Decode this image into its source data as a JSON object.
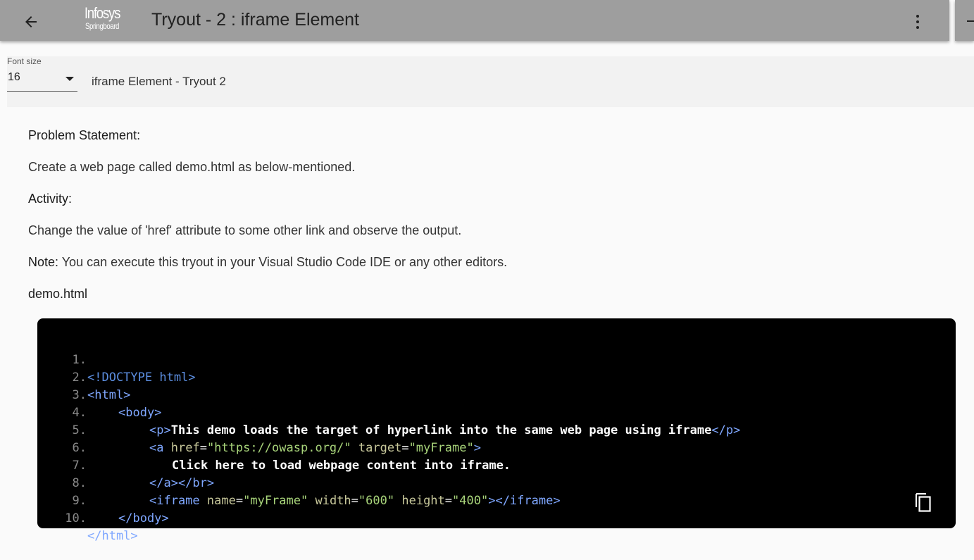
{
  "header": {
    "logo_line1": "Infosys",
    "logo_line2": "Springboard",
    "title": "Tryout - 2 : iframe Element"
  },
  "toolbar": {
    "font_size_label": "Font size",
    "font_size_value": "16",
    "lesson_title": "iframe Element - Tryout 2"
  },
  "content": {
    "problem_heading": "Problem Statement:",
    "problem_text": "Create a web page called demo.html as below-mentioned.",
    "activity_heading": "Activity:",
    "activity_text": "Change the value of 'href' attribute to some other link and observe the output.",
    "note_label": "Note:",
    "note_text": " You can execute this tryout in your Visual Studio Code IDE or any other editors.",
    "file_name": "demo.html"
  },
  "code": {
    "line_numbers": [
      "1.",
      "2.",
      "3.",
      "4.",
      "5.",
      "6.",
      "7.",
      "8.",
      "9.",
      "10."
    ],
    "l1": "<!DOCTYPE html>",
    "l2": "<html>",
    "l3": "<body>",
    "l4_open": "<p>",
    "l4_text": "This demo loads the target of hyperlink into the same web page using iframe",
    "l4_close": "</p>",
    "l5_tag": "<a",
    "l5_attr1": "href",
    "l5_val1": "\"https://owasp.org/\"",
    "l5_attr2": "target",
    "l5_val2": "\"myFrame\"",
    "l5_end": ">",
    "l6_text": "Click here to load webpage content into iframe.",
    "l7": "</a></br>",
    "l8_tag": "<iframe",
    "l8_attr1": "name",
    "l8_val1": "\"myFrame\"",
    "l8_attr2": "width",
    "l8_val2": "\"600\"",
    "l8_attr3": "height",
    "l8_val3": "\"400\"",
    "l8_end": "></iframe>",
    "l9": "</body>",
    "l10": "</html>"
  },
  "colors": {
    "header_bg": "#9e9e9e",
    "code_bg": "#000000",
    "tag": "#7fa7ff",
    "attr": "#c7c79a",
    "string": "#a8d47a"
  },
  "icons": {
    "back": "arrow-left-icon",
    "more": "more-vertical-icon",
    "copy": "copy-icon"
  }
}
